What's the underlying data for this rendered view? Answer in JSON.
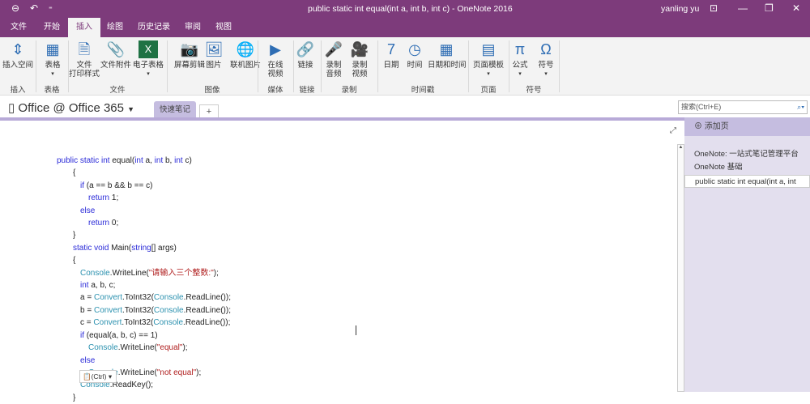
{
  "titlebar": {
    "title": "public static int equal(int a, int b, int c)  -  OneNote 2016",
    "user": "yanling yu"
  },
  "tabs": [
    "文件",
    "开始",
    "插入",
    "绘图",
    "历史记录",
    "审阅",
    "视图"
  ],
  "ribbon": {
    "buttons": [
      {
        "label": "插入空间",
        "icon": "insert-space-icon",
        "glyph": "⇕"
      },
      {
        "label": "表格",
        "icon": "table-icon",
        "glyph": "▦",
        "dd": "▾"
      },
      {
        "label": "文件\n打印样式",
        "icon": "file-printout-icon",
        "glyph": "🗎"
      },
      {
        "label": "文件附件",
        "icon": "paperclip-icon",
        "glyph": "📎"
      },
      {
        "label": "电子表格",
        "icon": "spreadsheet-icon",
        "glyph": "X",
        "dd": "▾"
      },
      {
        "label": "屏幕剪辑",
        "icon": "screen-clipping-icon",
        "glyph": "📷"
      },
      {
        "label": "图片",
        "icon": "picture-icon",
        "glyph": "🖼"
      },
      {
        "label": "联机图片",
        "icon": "online-picture-icon",
        "glyph": "🌐"
      },
      {
        "label": "在线\n视频",
        "icon": "online-video-icon",
        "glyph": "▶"
      },
      {
        "label": "链接",
        "icon": "link-icon",
        "glyph": "🔗"
      },
      {
        "label": "录制\n音频",
        "icon": "record-audio-icon",
        "glyph": "🎤"
      },
      {
        "label": "录制\n视频",
        "icon": "record-video-icon",
        "glyph": "🎥"
      },
      {
        "label": "日期",
        "icon": "calendar-icon",
        "glyph": "7"
      },
      {
        "label": "时间",
        "icon": "clock-icon",
        "glyph": "◷"
      },
      {
        "label": "日期和时间",
        "icon": "date-time-icon",
        "glyph": "▦"
      },
      {
        "label": "页面模板",
        "icon": "page-template-icon",
        "glyph": "▤",
        "dd": "▾"
      },
      {
        "label": "公式",
        "icon": "pi-icon",
        "glyph": "π",
        "dd": "▾"
      },
      {
        "label": "符号",
        "icon": "omega-icon",
        "glyph": "Ω",
        "dd": "▾"
      }
    ],
    "groups": [
      "插入",
      "表格",
      "文件",
      "图像",
      "媒体",
      "链接",
      "录制",
      "时间戳",
      "页面",
      "符号"
    ]
  },
  "notebook": {
    "name": "Office @ Office 365",
    "section": "快速笔记",
    "add_tab": "+",
    "search_placeholder": "搜索(Ctrl+E)"
  },
  "pages": {
    "add_label": "添加页",
    "items": [
      "OneNote: 一站式笔记管理平台",
      "OneNote 基础",
      "public static int equal(int a, int"
    ]
  },
  "paste_options": "(Ctrl) ▾",
  "code": [
    [
      0,
      [
        [
          "kw",
          "public static int "
        ],
        [
          "",
          "equal("
        ],
        [
          "kw",
          "int"
        ],
        [
          "",
          " a, "
        ],
        [
          "kw",
          "int"
        ],
        [
          "",
          " b, "
        ],
        [
          "kw",
          "int"
        ],
        [
          "",
          " c)"
        ]
      ]
    ],
    [
      1,
      [
        [
          "",
          "{"
        ]
      ]
    ],
    [
      2,
      [
        [
          "kw",
          "if"
        ],
        [
          "",
          " (a == b && b == c)"
        ]
      ]
    ],
    [
      3,
      [
        [
          "kw",
          "return"
        ],
        [
          "",
          " 1;"
        ]
      ]
    ],
    [
      2,
      [
        [
          "kw",
          "else"
        ]
      ]
    ],
    [
      3,
      [
        [
          "kw",
          "return"
        ],
        [
          "",
          " 0;"
        ]
      ]
    ],
    [
      1,
      [
        [
          "",
          "}"
        ]
      ]
    ],
    [
      1,
      [
        [
          "kw",
          "static void "
        ],
        [
          "",
          "Main("
        ],
        [
          "kw",
          "string"
        ],
        [
          "",
          "[] args)"
        ]
      ]
    ],
    [
      1,
      [
        [
          "",
          "{"
        ]
      ]
    ],
    [
      2,
      [
        [
          "ty",
          "Console"
        ],
        [
          "",
          ".WriteLine("
        ],
        [
          "st",
          "\"请输入三个整数:\""
        ],
        [
          "",
          ");"
        ]
      ]
    ],
    [
      2,
      [
        [
          "kw",
          "int"
        ],
        [
          "",
          " a, b, c;"
        ]
      ]
    ],
    [
      2,
      [
        [
          "",
          "a = "
        ],
        [
          "ty",
          "Convert"
        ],
        [
          "",
          ".ToInt32("
        ],
        [
          "ty",
          "Console"
        ],
        [
          "",
          ".ReadLine());"
        ]
      ]
    ],
    [
      2,
      [
        [
          "",
          "b = "
        ],
        [
          "ty",
          "Convert"
        ],
        [
          "",
          ".ToInt32("
        ],
        [
          "ty",
          "Console"
        ],
        [
          "",
          ".ReadLine());"
        ]
      ]
    ],
    [
      2,
      [
        [
          "",
          "c = "
        ],
        [
          "ty",
          "Convert"
        ],
        [
          "",
          ".ToInt32("
        ],
        [
          "ty",
          "Console"
        ],
        [
          "",
          ".ReadLine());"
        ]
      ]
    ],
    [
      2,
      [
        [
          "kw",
          "if"
        ],
        [
          "",
          " (equal(a, b, c) == 1)"
        ]
      ]
    ],
    [
      3,
      [
        [
          "ty",
          "Console"
        ],
        [
          "",
          ".WriteLine("
        ],
        [
          "st",
          "\"equal\""
        ],
        [
          "",
          ");"
        ]
      ]
    ],
    [
      2,
      [
        [
          "kw",
          "else"
        ]
      ]
    ],
    [
      3,
      [
        [
          "ty",
          "Console"
        ],
        [
          "",
          ".WriteLine("
        ],
        [
          "st",
          "\"not equal\""
        ],
        [
          "",
          ");"
        ]
      ]
    ],
    [
      2,
      [
        [
          "ty",
          "Console"
        ],
        [
          "",
          ".ReadKey();"
        ]
      ]
    ],
    [
      1,
      [
        [
          "",
          "}"
        ]
      ]
    ]
  ]
}
